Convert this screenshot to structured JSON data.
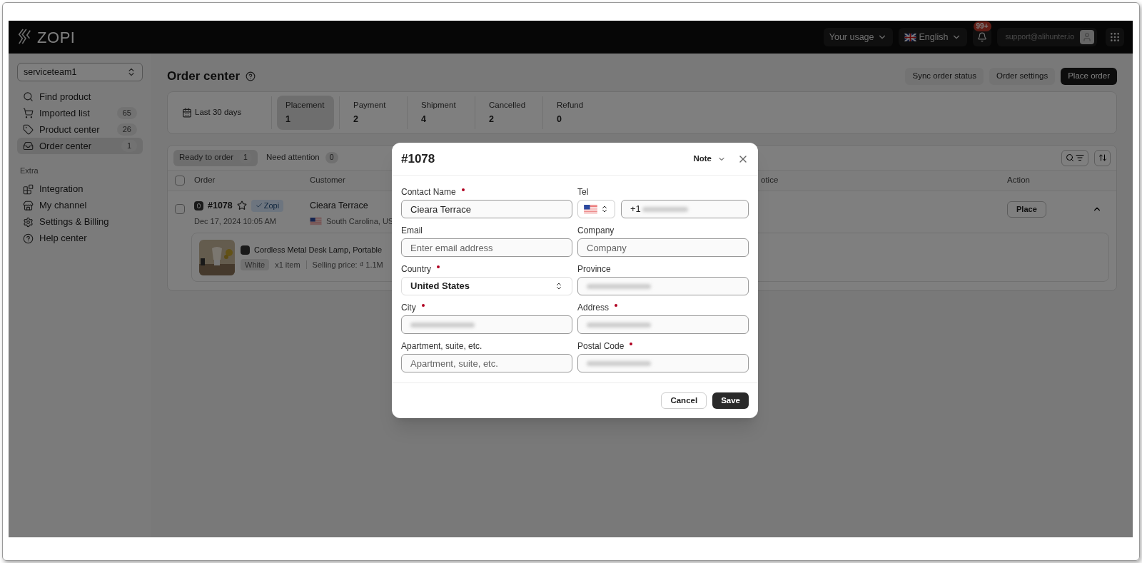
{
  "topbar": {
    "logo": "ZOPI",
    "usage": "Your usage",
    "language": "English",
    "notifications": "99+",
    "account": "support@alihunter.io"
  },
  "sidebar": {
    "workspace": "serviceteam1",
    "items": [
      {
        "label": "Find product",
        "selected": false
      },
      {
        "label": "Imported list",
        "count": "65",
        "selected": false
      },
      {
        "label": "Product center",
        "count": "26",
        "selected": false
      },
      {
        "label": "Order center",
        "count": "1",
        "selected": true
      }
    ],
    "section": "Extra",
    "extra": [
      {
        "label": "Integration",
        "selected": false
      },
      {
        "label": "My channel",
        "selected": false
      },
      {
        "label": "Settings & Billing",
        "selected": false
      },
      {
        "label": "Help center",
        "selected": false
      }
    ]
  },
  "page": {
    "title": "Order center",
    "actions": [
      {
        "label": "Sync order status",
        "primary": false
      },
      {
        "label": "Order settings",
        "primary": false
      },
      {
        "label": "Place order",
        "primary": true
      }
    ]
  },
  "stats": {
    "range": "Last 30 days",
    "items": [
      {
        "label": "Placement",
        "value": "1",
        "selected": true
      },
      {
        "label": "Payment",
        "value": "2",
        "selected": false
      },
      {
        "label": "Shipment",
        "value": "4",
        "selected": false
      },
      {
        "label": "Cancelled",
        "value": "2",
        "selected": false
      },
      {
        "label": "Refund",
        "value": "0",
        "selected": false
      }
    ]
  },
  "table": {
    "tabs": [
      {
        "label": "Ready to order",
        "count": "1",
        "selected": true
      },
      {
        "label": "Need attention",
        "count": "0",
        "selected": false
      }
    ],
    "select_all": {
      "checked": false
    },
    "columns": [
      "Order",
      "Customer",
      "otice",
      "Action"
    ],
    "rows": [
      {
        "checked": false,
        "order": "#1078",
        "badge": "Zopi",
        "date": "Dec 17, 2024 10:05 AM",
        "customer": "Cieara Terrace",
        "location": "South Carolina, US",
        "action": "Place",
        "expanded": true,
        "product": {
          "title": "Cordless Metal Desk Lamp, Portable",
          "variant": "White",
          "quantity": "x1 item",
          "price": "Selling price: ₫ 1.1M"
        }
      }
    ]
  },
  "modal": {
    "title": "#1078",
    "note": "Note",
    "fields": [
      {
        "label": "Contact Name",
        "required": true,
        "kind": "text",
        "value": "Cieara Terrace"
      },
      {
        "label": "Tel",
        "required": false,
        "kind": "phone",
        "value": "+1",
        "blurred": true
      },
      {
        "label": "Email",
        "required": false,
        "kind": "text",
        "placeholder": "Enter email address"
      },
      {
        "label": "Company",
        "required": false,
        "kind": "text",
        "placeholder": "Company"
      },
      {
        "label": "Country",
        "required": true,
        "kind": "select",
        "value": "United States"
      },
      {
        "label": "Province",
        "required": false,
        "kind": "text",
        "blurred": true
      },
      {
        "label": "City",
        "required": true,
        "kind": "text",
        "blurred": true
      },
      {
        "label": "Address",
        "required": true,
        "kind": "text",
        "blurred": true
      },
      {
        "label": "Apartment, suite, etc.",
        "required": false,
        "kind": "text",
        "placeholder": "Apartment, suite, etc."
      },
      {
        "label": "Postal Code",
        "required": true,
        "kind": "text",
        "blurred": true
      }
    ],
    "buttons": [
      {
        "label": "Cancel",
        "primary": false
      },
      {
        "label": "Save",
        "primary": true
      }
    ]
  }
}
